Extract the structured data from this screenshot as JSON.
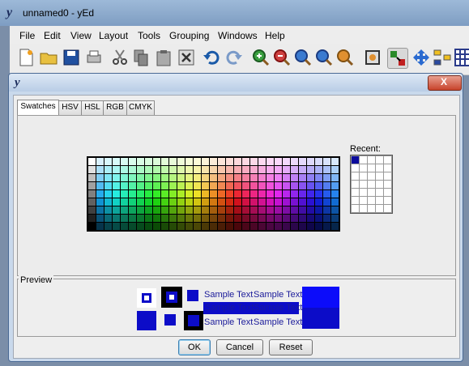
{
  "window": {
    "title": "unnamed0 - yEd",
    "logo": "y"
  },
  "menu": [
    "File",
    "Edit",
    "View",
    "Layout",
    "Tools",
    "Grouping",
    "Windows",
    "Help"
  ],
  "toolbar_icons": [
    "new-document-icon",
    "open-folder-icon",
    "save-icon",
    "print-icon",
    "cut-icon",
    "copy-icon",
    "paste-icon",
    "delete-icon",
    "undo-icon",
    "redo-icon",
    "zoom-in-icon",
    "zoom-out-icon",
    "zoom-original-icon",
    "zoom-area-icon",
    "zoom-fit-icon",
    "fit-content-icon",
    "edit-mode-icon",
    "navigate-icon",
    "layout-icon",
    "grid-icon"
  ],
  "dialog": {
    "logo": "y",
    "close_label": "X",
    "tabs": [
      {
        "label": "Swatches",
        "active": true
      },
      {
        "label": "HSV",
        "active": false
      },
      {
        "label": "HSL",
        "active": false
      },
      {
        "label": "RGB",
        "active": false
      },
      {
        "label": "CMYK",
        "active": false
      }
    ],
    "recent_label": "Recent:",
    "recent_selected": "#0c0c9c",
    "preview_label": "Preview",
    "sample_text": "Sample Text",
    "selected_color": "#0c0cc8",
    "buttons": {
      "ok": "OK",
      "cancel": "Cancel",
      "reset": "Reset"
    }
  }
}
